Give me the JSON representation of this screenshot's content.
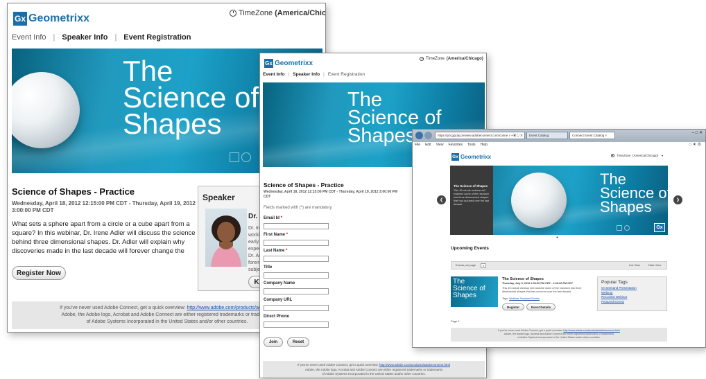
{
  "brand": {
    "logo_mark": "Gx",
    "logo_name": "Geometrixx"
  },
  "timezone": {
    "label": "TimeZone",
    "value": "(America/Chicago)"
  },
  "nav": {
    "event_info": "Event Info",
    "speaker_info": "Speaker Info",
    "event_registration": "Event Registration"
  },
  "banner": {
    "line1": "The",
    "line2": "Science of",
    "line3": "Shapes"
  },
  "event": {
    "title": "Science of Shapes - Practice",
    "date_range": "Wednesday, April 18, 2012 12:15:00 PM CDT - Thursday, April 19, 2012 3:00:00 PM CDT",
    "description": "What sets a sphere apart from a circle or a cube apart from a square?  In this webinar, Dr. Irene Adler will discuss the science behind three dimensional shapes.  Dr. Adler will explain why discoveries made in the last decade will forever change the shape of science and the science of shapes"
  },
  "register_button": "Register Now",
  "speaker": {
    "heading": "Speaker",
    "name": "Dr. I",
    "bio_lines": [
      "Dr. Ire",
      "worki",
      "early",
      "exper",
      "Dr. Ac",
      "forem",
      "subje"
    ],
    "more_button": "K"
  },
  "footer": {
    "line1_prefix": "If you've never used Adobe Connect, get a quick overview:",
    "link": "http://www.adobe.com/products/adobeconnect.html",
    "line2": "Adobe, the Adobe logo, Acrobat and Adobe Connect are either registered trademarks or trademarks",
    "line3": "of Adobe Systems Incorporated in the United States and/or other countries.",
    "link_clipped": "http://www.adobe.com/products/adobeco",
    "line2_clipped": "Adobe, the Adobe logo, Acrobat and Adobe Connect are either registered trademarks or trademark"
  },
  "form": {
    "mandatory_note": "Fields marked with (*) are mandatory.",
    "fields": [
      {
        "label": "Email Id",
        "required": true
      },
      {
        "label": "First Name",
        "required": true
      },
      {
        "label": "Last Name",
        "required": true
      },
      {
        "label": "Title",
        "required": false
      },
      {
        "label": "Company Name",
        "required": false
      },
      {
        "label": "Company URL",
        "required": false
      },
      {
        "label": "Direct Phone",
        "required": false
      }
    ],
    "required_mark": "*",
    "join_button": "Join",
    "reset_button": "Reset"
  },
  "browser": {
    "url": "https://pzcgqcijs.preview.adobeconnect.com/conne",
    "url_controls": "⌕ ▾ ▣ ↻ ✕",
    "tab1": "Event Catalog",
    "tab2": "Connect Event Catalog",
    "tab_close": "×",
    "menu": [
      "File",
      "Edit",
      "View",
      "Favorites",
      "Tools",
      "Help"
    ],
    "window_controls": "‒ □ ✕",
    "right_icons": "⌂ ★ ⚙"
  },
  "catalog": {
    "slide_caption_title": "The Science of Shapes",
    "slide_caption_body": "This 45 minute webinar will examine some of the research into three dimensional shapes that has occurred over the last decade",
    "prev_icon": "❮",
    "next_icon": "❯",
    "dot": "●",
    "section_title": "Upcoming Events",
    "events_per_page_label": "Events per page",
    "events_per_page_value": "5",
    "list_view": "List View",
    "date_view": "Date View",
    "event_title": "The Science of Shapes",
    "event_date": "Thursday, July 5, 2012 1:00:00 PM CDT - 2:00:00 PM CDT",
    "event_desc": "This 45 minute webinar will examine some of the research into three dimensional shapes that has occurred over the last decade.",
    "tags_label": "Tags:",
    "tags": "Webinar, Featured Events",
    "register_button": "Register",
    "details_button": "Event Details",
    "popular_tags_title": "Popular Tags",
    "popular_tags": [
      "On Demand Presentation",
      "Webinar",
      "Recorded Webinar",
      "Featured Events"
    ],
    "page_label": "Page 1"
  }
}
